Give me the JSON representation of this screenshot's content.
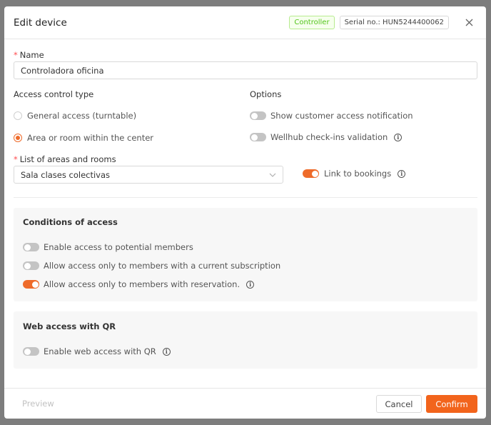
{
  "dialog": {
    "title": "Edit device",
    "badge_type": "Controller",
    "badge_serial": "Serial no.: HUN5244400062"
  },
  "name_field": {
    "label": "Name",
    "required_mark": "*",
    "value": "Controladora oficina"
  },
  "access_control": {
    "label": "Access control type",
    "options": [
      {
        "label": "General access (turntable)",
        "selected": false
      },
      {
        "label": "Area or room within the center",
        "selected": true
      }
    ]
  },
  "options": {
    "label": "Options",
    "items": [
      {
        "label": "Show customer access notification",
        "on": false
      },
      {
        "label": "Wellhub check-ins validation",
        "on": false
      }
    ]
  },
  "areas": {
    "label": "List of areas and rooms",
    "required_mark": "*",
    "value": "Sala clases colectivas"
  },
  "link_bookings": {
    "label": "Link to bookings",
    "on": true
  },
  "conditions": {
    "title": "Conditions of access",
    "items": [
      {
        "label": "Enable access to potential members",
        "on": false
      },
      {
        "label": "Allow access only to members with a current subscription",
        "on": false
      },
      {
        "label": "Allow access only to members with reservation.",
        "on": true
      }
    ]
  },
  "web_access": {
    "title": "Web access with QR",
    "items": [
      {
        "label": "Enable web access with QR",
        "on": false
      }
    ]
  },
  "footer": {
    "preview_label": "Preview",
    "cancel_label": "Cancel",
    "confirm_label": "Confirm"
  },
  "colors": {
    "accent": "#ee6b2a",
    "primary_button": "#f2641c",
    "required": "#ff4d4f",
    "badge_green": "#52c41a"
  }
}
